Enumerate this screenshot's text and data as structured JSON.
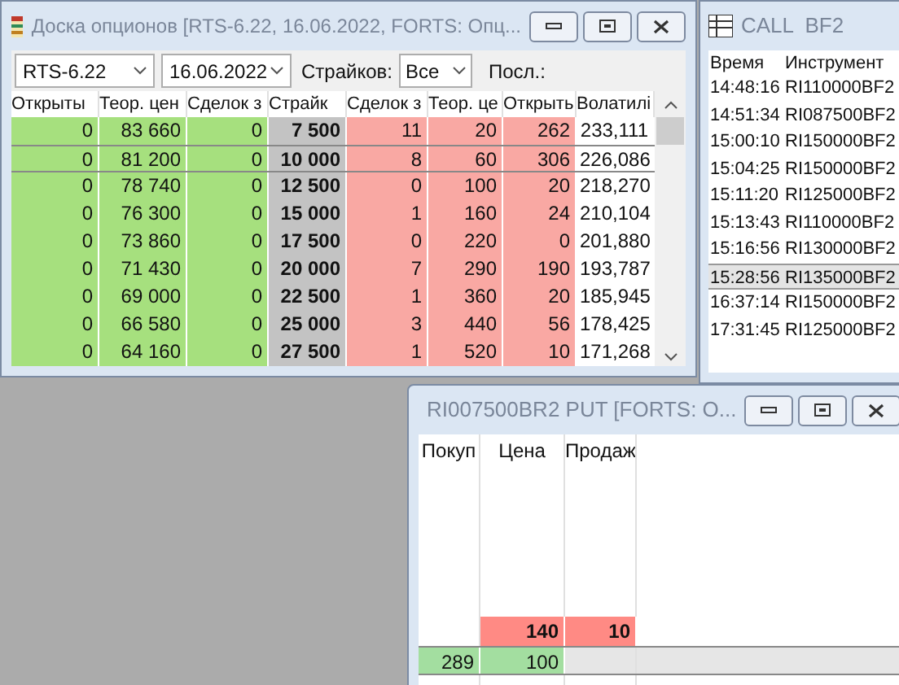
{
  "options_board": {
    "title": "Доска опционов [RTS-6.22, 16.06.2022, FORTS: Опц...",
    "underlying": "RTS-6.22",
    "expiry": "16.06.2022",
    "strikes_label": "Страйков:",
    "strikes_value": "Все",
    "last_label": "Посл.:",
    "columns": [
      {
        "label": "Открыты",
        "kind": "call"
      },
      {
        "label": "Теор. цен",
        "kind": "call"
      },
      {
        "label": "Сделок з",
        "kind": "call"
      },
      {
        "label": "Страйк",
        "kind": "strike"
      },
      {
        "label": "Сделок з",
        "kind": "put"
      },
      {
        "label": "Теор. це",
        "kind": "put"
      },
      {
        "label": "Открыть",
        "kind": "put"
      },
      {
        "label": "Волатилі",
        "kind": "plain"
      }
    ],
    "rows": [
      {
        "selected": false,
        "cells": [
          "0",
          "83 660",
          "0",
          "7 500",
          "11",
          "20",
          "262",
          "233,111"
        ]
      },
      {
        "selected": true,
        "cells": [
          "0",
          "81 200",
          "0",
          "10 000",
          "8",
          "60",
          "306",
          "226,086"
        ]
      },
      {
        "selected": false,
        "cells": [
          "0",
          "78 740",
          "0",
          "12 500",
          "0",
          "100",
          "20",
          "218,270"
        ]
      },
      {
        "selected": false,
        "cells": [
          "0",
          "76 300",
          "0",
          "15 000",
          "1",
          "160",
          "24",
          "210,104"
        ]
      },
      {
        "selected": false,
        "cells": [
          "0",
          "73 860",
          "0",
          "17 500",
          "0",
          "220",
          "0",
          "201,880"
        ]
      },
      {
        "selected": false,
        "cells": [
          "0",
          "71 430",
          "0",
          "20 000",
          "7",
          "290",
          "190",
          "193,787"
        ]
      },
      {
        "selected": false,
        "cells": [
          "0",
          "69 000",
          "0",
          "22 500",
          "1",
          "360",
          "20",
          "185,945"
        ]
      },
      {
        "selected": false,
        "cells": [
          "0",
          "66 580",
          "0",
          "25 000",
          "3",
          "440",
          "56",
          "178,425"
        ]
      },
      {
        "selected": false,
        "cells": [
          "0",
          "64 160",
          "0",
          "27 500",
          "1",
          "520",
          "10",
          "171,268"
        ]
      }
    ]
  },
  "trades_window": {
    "title": "CALL  BF2",
    "columns": [
      "Время",
      "Инструмент"
    ],
    "rows": [
      {
        "time": "14:48:16",
        "instrument": "RI110000BF2",
        "selected": false
      },
      {
        "time": "14:51:34",
        "instrument": "RI087500BF2",
        "selected": false
      },
      {
        "time": "15:00:10",
        "instrument": "RI150000BF2",
        "selected": false
      },
      {
        "time": "15:04:25",
        "instrument": "RI150000BF2",
        "selected": false
      },
      {
        "time": "15:11:20",
        "instrument": "RI125000BF2",
        "selected": false
      },
      {
        "time": "15:13:43",
        "instrument": "RI110000BF2",
        "selected": false
      },
      {
        "time": "15:16:56",
        "instrument": "RI130000BF2",
        "selected": false
      },
      {
        "time": "15:28:56",
        "instrument": "RI135000BF2",
        "selected": true
      },
      {
        "time": "16:37:14",
        "instrument": "RI150000BF2",
        "selected": false
      },
      {
        "time": "17:31:45",
        "instrument": "RI125000BF2",
        "selected": false
      }
    ]
  },
  "order_book": {
    "title": "RI007500BR2 PUT [FORTS: O...",
    "columns": [
      "Покуп",
      "Цена",
      "Продаж"
    ],
    "rows": [
      {
        "kind": "sell",
        "cells": [
          "",
          "140",
          "10"
        ]
      },
      {
        "kind": "buy",
        "cells": [
          "289",
          "100",
          ""
        ]
      }
    ]
  }
}
